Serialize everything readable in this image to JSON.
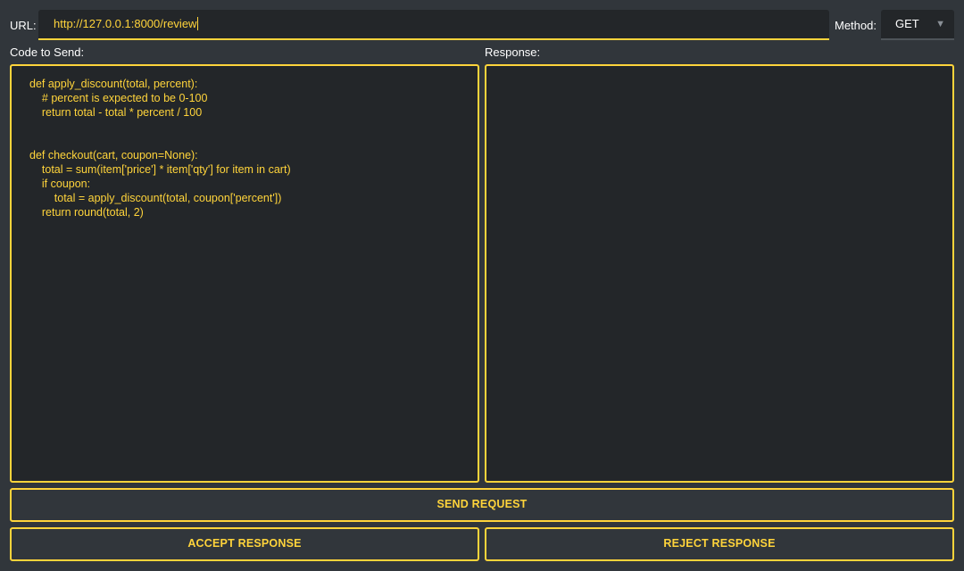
{
  "url_label": "URL:",
  "url_value": "http://127.0.0.1:8000/review",
  "method_label": "Method:",
  "method_selected": "GET",
  "code_label": "Code to Send:",
  "response_label": "Response:",
  "code": "def apply_discount(total, percent):\n    # percent is expected to be 0-100\n    return total - total * percent / 100\n\n\ndef checkout(cart, coupon=None):\n    total = sum(item['price'] * item['qty'] for item in cart)\n    if coupon:\n        total = apply_discount(total, coupon['percent'])\n    return round(total, 2)",
  "response_text": "",
  "buttons": {
    "send": "SEND REQUEST",
    "accept": "ACCEPT RESPONSE",
    "reject": "REJECT RESPONSE"
  },
  "icons": {
    "dropdown": "chevron-down-icon"
  },
  "colors": {
    "accent": "#ffd43b",
    "background": "#31363b",
    "field": "#232629",
    "text": "#ffffff"
  }
}
